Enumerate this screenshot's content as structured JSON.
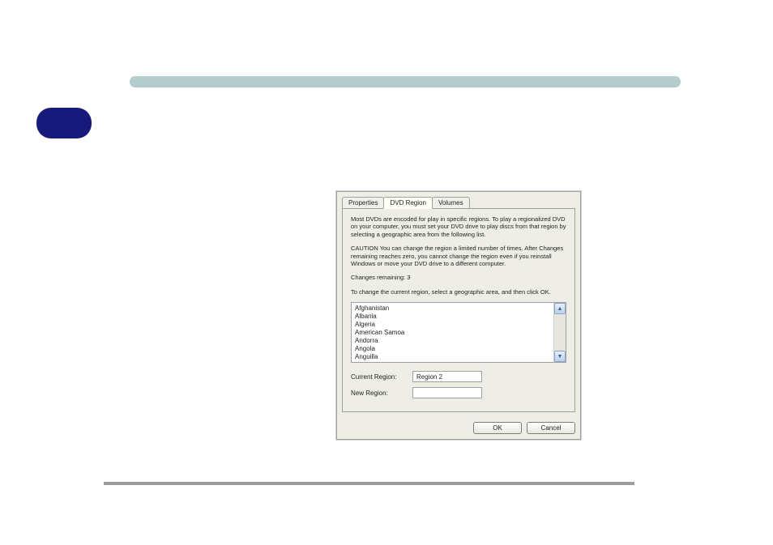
{
  "tabs": {
    "properties": "Properties",
    "dvd_region": "DVD Region",
    "volumes": "Volumes"
  },
  "panel": {
    "intro": "Most DVDs are encoded for play in specific regions. To play a regionalized DVD on your computer, you must set your DVD drive to play discs from that region by selecting a geographic area from the following list.",
    "caution": "CAUTION   You can change the region a limited number of times. After Changes remaining reaches zero, you cannot change the region even if you reinstall Windows or move your DVD drive to a different computer.",
    "changes_remaining": "Changes remaining: 3",
    "instruction": "To change the current region, select a geographic area, and then click OK.",
    "list": [
      "Afghanistan",
      "Albania",
      "Algeria",
      "American Samoa",
      "Andorra",
      "Angola",
      "Anguilla"
    ],
    "current_region_label": "Current Region:",
    "current_region_value": "Region 2",
    "new_region_label": "New Region:",
    "new_region_value": ""
  },
  "buttons": {
    "ok": "OK",
    "cancel": "Cancel"
  },
  "scroll": {
    "up": "▲",
    "down": "▼"
  }
}
